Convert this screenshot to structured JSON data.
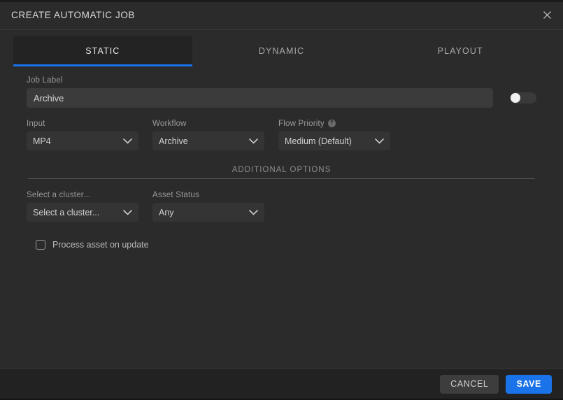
{
  "header": {
    "title": "CREATE AUTOMATIC JOB",
    "close_icon": "close-icon"
  },
  "tabs": [
    {
      "label": "STATIC",
      "active": true
    },
    {
      "label": "DYNAMIC",
      "active": false
    },
    {
      "label": "PLAYOUT",
      "active": false
    }
  ],
  "form": {
    "job_label": {
      "label": "Job Label",
      "value": "Archive",
      "placeholder": "Job Label"
    },
    "toggle": {
      "state": "off"
    },
    "input": {
      "label": "Input",
      "value": "MP4"
    },
    "workflow": {
      "label": "Workflow",
      "value": "Archive"
    },
    "flow_priority": {
      "label": "Flow Priority",
      "value": "Medium (Default)",
      "help_icon": "question-mark-icon"
    },
    "additional_options": {
      "title": "ADDITIONAL OPTIONS"
    },
    "cluster": {
      "label": "Select a cluster...",
      "value": "Select a cluster..."
    },
    "asset_status": {
      "label": "Asset Status",
      "value": "Any"
    },
    "process_asset": {
      "label": "Process asset on update",
      "checked": false
    }
  },
  "footer": {
    "cancel_label": "CANCEL",
    "save_label": "SAVE"
  },
  "colors": {
    "accent": "#1a73e8",
    "background": "#2b2b2b",
    "panel": "#232323",
    "field": "#343434",
    "footer": "#222222"
  }
}
